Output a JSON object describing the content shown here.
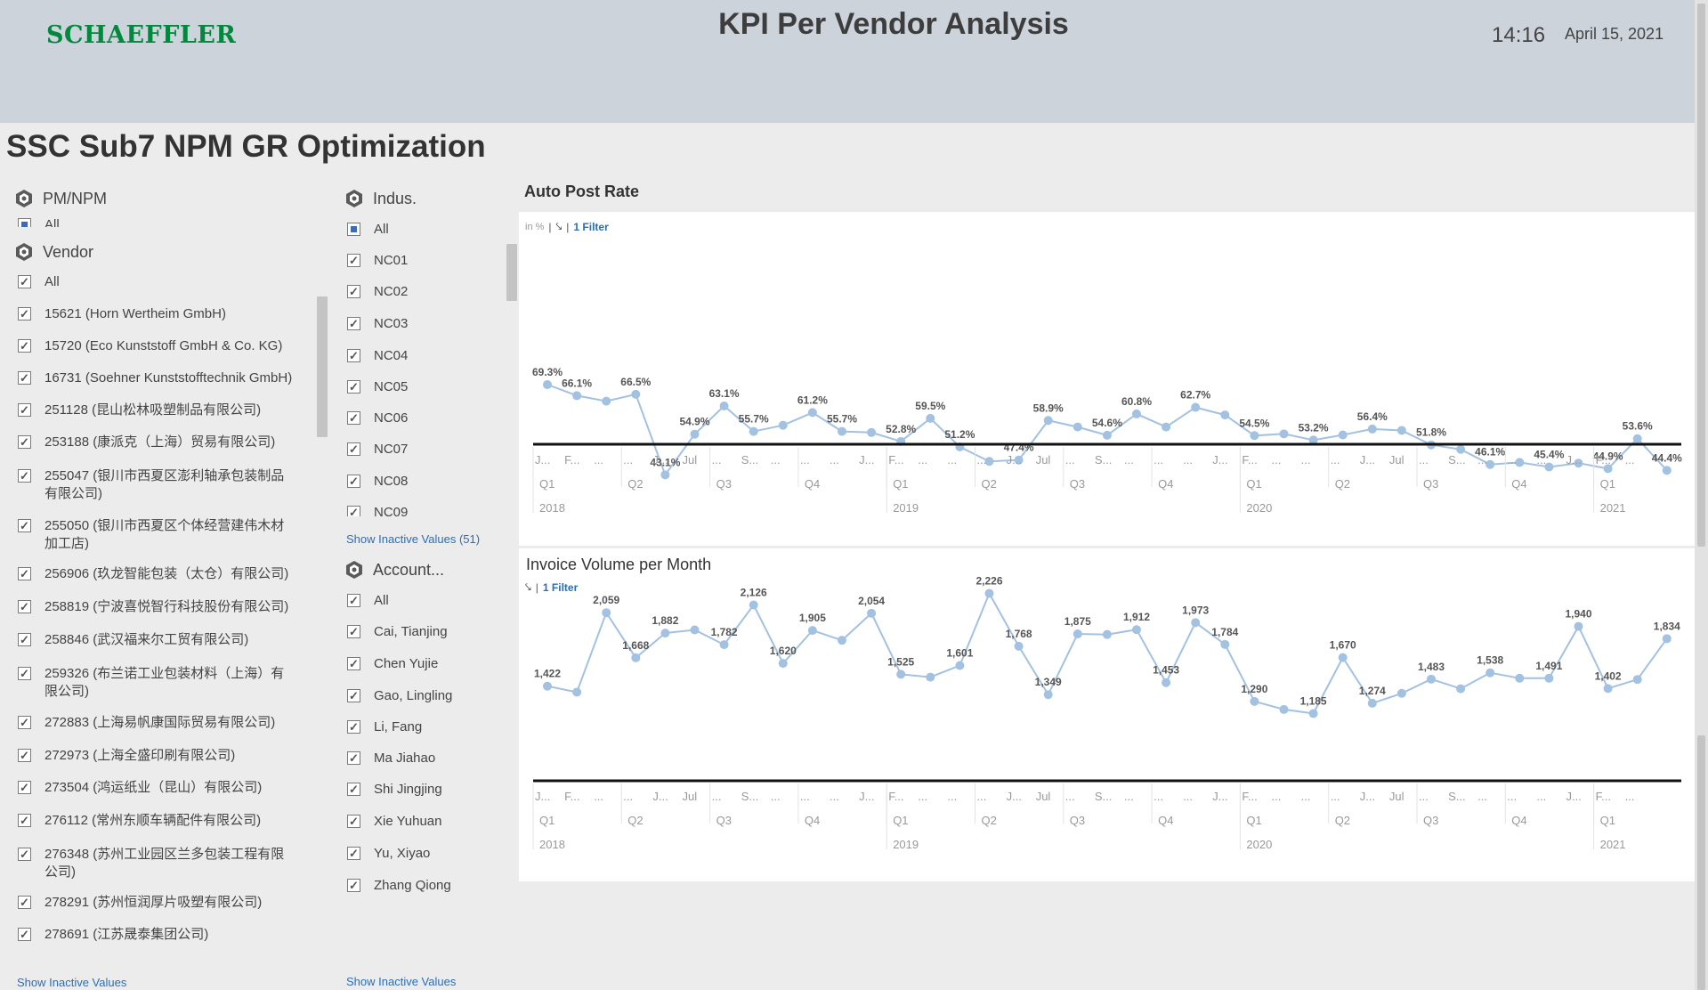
{
  "header": {
    "logo": "SCHAEFFLER",
    "title": "KPI Per Vendor Analysis",
    "clock": "14:16",
    "date": "April 15, 2021"
  },
  "page": {
    "title": "SSC Sub7 NPM GR Optimization"
  },
  "filters": {
    "pm_npm": {
      "title": "PM/NPM",
      "all_label": "All"
    },
    "vendor": {
      "title": "Vendor",
      "items": [
        "All",
        "15621 (Horn Wertheim GmbH)",
        "15720 (Eco Kunststoff GmbH & Co. KG)",
        "16731 (Soehner Kunststofftechnik GmbH)",
        "251128 (昆山松林吸塑制品有限公司)",
        "253188 (康派克（上海）贸易有限公司)",
        "255047 (银川市西夏区澎利轴承包装制品有限公司)",
        "255050 (银川市西夏区个体经营建伟木材加工店)",
        "256906 (玖龙智能包装（太仓）有限公司)",
        "258819 (宁波喜悦智行科技股份有限公司)",
        "258846 (武汉福来尔工贸有限公司)",
        "259326 (布兰诺工业包装材料（上海）有限公司)",
        "272883 (上海易帆康国际贸易有限公司)",
        "272973 (上海全盛印刷有限公司)",
        "273504 (鸿运纸业（昆山）有限公司)",
        "276112 (常州东顺车辆配件有限公司)",
        "276348 (苏州工业园区兰多包装工程有限公司)",
        "278291 (苏州恒润厚片吸塑有限公司)",
        "278691 (江苏晟泰集团公司)"
      ],
      "show_inactive": "Show Inactive Values"
    },
    "industry": {
      "title": "Indus.",
      "items": [
        "All",
        "NC01",
        "NC02",
        "NC03",
        "NC04",
        "NC05",
        "NC06",
        "NC07",
        "NC08",
        "NC09"
      ],
      "show_inactive": "Show Inactive Values (51)"
    },
    "account": {
      "title": "Account...",
      "items": [
        "All",
        "Cai, Tianjing",
        "Chen Yujie",
        "Gao, Lingling",
        "Li, Fang",
        "Ma Jiahao",
        "Shi Jingjing",
        "Xie Yuhuan",
        "Yu, Xiyao",
        "Zhang Qiong"
      ],
      "show_inactive": "Show Inactive Values"
    }
  },
  "charts": {
    "auto_post": {
      "title": "Auto Post Rate",
      "unit": "in %",
      "filter": "1 Filter"
    },
    "invoice": {
      "title": "Invoice Volume per Month",
      "filter": "1 Filter"
    }
  },
  "axis": {
    "month_labels": [
      "J...",
      "F...",
      "...",
      "...",
      "J...",
      "Jul",
      "...",
      "S...",
      "...",
      "...",
      "...",
      "J...",
      "F...",
      "...",
      "...",
      "...",
      "J...",
      "Jul",
      "...",
      "S...",
      "...",
      "...",
      "...",
      "J...",
      "F...",
      "...",
      "...",
      "...",
      "J...",
      "Jul",
      "...",
      "S...",
      "...",
      "...",
      "...",
      "J...",
      "F...",
      "..."
    ],
    "quarter_labels": [
      "Q1",
      "Q2",
      "Q3",
      "Q4",
      "Q1",
      "Q2",
      "Q3",
      "Q4",
      "Q1",
      "Q2",
      "Q3",
      "Q4",
      "Q1"
    ],
    "year_labels": [
      "2018",
      "2019",
      "2020",
      "2021"
    ]
  },
  "chart_data": [
    {
      "type": "line",
      "title": "Auto Post Rate",
      "unit": "in %",
      "x": [
        "2018-01",
        "2018-02",
        "2018-03",
        "2018-04",
        "2018-05",
        "2018-06",
        "2018-07",
        "2018-08",
        "2018-09",
        "2018-10",
        "2018-11",
        "2018-12",
        "2019-01",
        "2019-02",
        "2019-03",
        "2019-04",
        "2019-05",
        "2019-06",
        "2019-07",
        "2019-08",
        "2019-09",
        "2019-10",
        "2019-11",
        "2019-12",
        "2020-01",
        "2020-02",
        "2020-03",
        "2020-04",
        "2020-05",
        "2020-06",
        "2020-07",
        "2020-08",
        "2020-09",
        "2020-10",
        "2020-11",
        "2020-12",
        "2021-01",
        "2021-02",
        "2021-03"
      ],
      "values": [
        69.3,
        66.1,
        64.5,
        66.5,
        43.1,
        54.9,
        63.1,
        55.7,
        57.5,
        61.2,
        55.7,
        55.4,
        52.8,
        59.5,
        51.2,
        47.0,
        47.4,
        58.9,
        57.0,
        54.6,
        60.8,
        57.0,
        62.7,
        60.5,
        54.5,
        55.0,
        53.2,
        54.7,
        56.4,
        56.0,
        51.8,
        50.5,
        46.1,
        46.7,
        45.4,
        46.5,
        44.9,
        53.6,
        44.4
      ],
      "labels": [
        "69.3%",
        "66.1%",
        "",
        "66.5%",
        "43.1%",
        "54.9%",
        "63.1%",
        "55.7%",
        "",
        "61.2%",
        "55.7%",
        "",
        "52.8%",
        "59.5%",
        "51.2%",
        "",
        "47.4%",
        "58.9%",
        "",
        "54.6%",
        "60.8%",
        "",
        "62.7%",
        "",
        "54.5%",
        "",
        "53.2%",
        "",
        "56.4%",
        "",
        "51.8%",
        "",
        "46.1%",
        "",
        "45.4%",
        "",
        "44.9%",
        "53.6%",
        "44.4%"
      ],
      "ylim": [
        0,
        75
      ],
      "color": "#a3c1e0"
    },
    {
      "type": "line",
      "title": "Invoice Volume per Month",
      "x": [
        "2018-01",
        "2018-02",
        "2018-03",
        "2018-04",
        "2018-05",
        "2018-06",
        "2018-07",
        "2018-08",
        "2018-09",
        "2018-10",
        "2018-11",
        "2018-12",
        "2019-01",
        "2019-02",
        "2019-03",
        "2019-04",
        "2019-05",
        "2019-06",
        "2019-07",
        "2019-08",
        "2019-09",
        "2019-10",
        "2019-11",
        "2019-12",
        "2020-01",
        "2020-02",
        "2020-03",
        "2020-04",
        "2020-05",
        "2020-06",
        "2020-07",
        "2020-08",
        "2020-09",
        "2020-10",
        "2020-11",
        "2020-12",
        "2021-01",
        "2021-02",
        "2021-03"
      ],
      "values": [
        1422,
        1370,
        2059,
        1668,
        1882,
        1910,
        1782,
        2126,
        1620,
        1905,
        1820,
        2054,
        1525,
        1500,
        1601,
        2226,
        1768,
        1349,
        1875,
        1870,
        1912,
        1453,
        1973,
        1784,
        1290,
        1220,
        1185,
        1670,
        1274,
        1360,
        1483,
        1400,
        1538,
        1491,
        1491,
        1940,
        1402,
        1480,
        1834
      ],
      "labels": [
        "1,422",
        "",
        "2,059",
        "1,668",
        "1,882",
        "",
        "1,782",
        "2,126",
        "1,620",
        "1,905",
        "",
        "2,054",
        "1,525",
        "",
        "1,601",
        "2,226",
        "1,768",
        "1,349",
        "1,875",
        "",
        "1,912",
        "1,453",
        "1,973",
        "1,784",
        "1,290",
        "",
        "1,185",
        "1,670",
        "1,274",
        "",
        "1,483",
        "",
        "1,538",
        "",
        "1,491",
        "1,940",
        "1,402",
        "",
        "1,834"
      ],
      "ylim": [
        0,
        2400
      ],
      "color": "#a3c1e0"
    }
  ]
}
